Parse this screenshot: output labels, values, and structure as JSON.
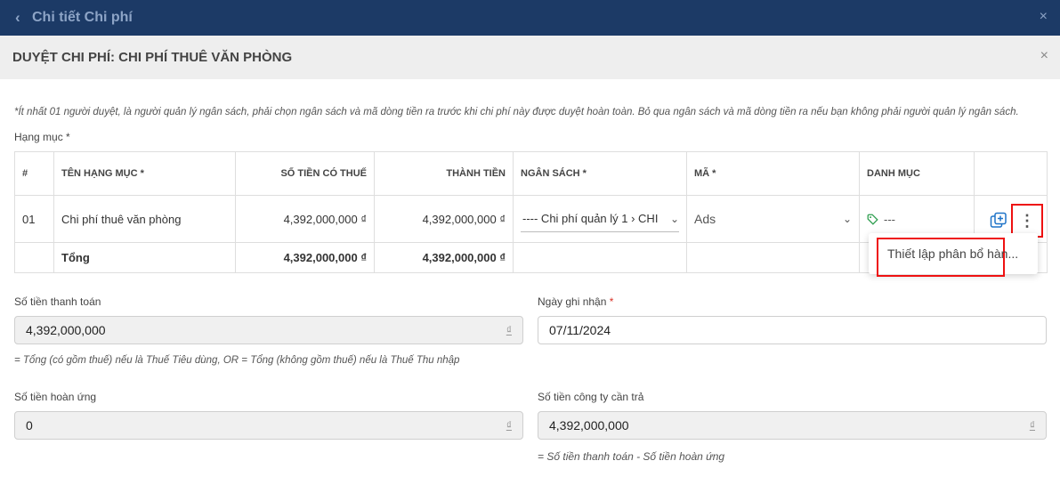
{
  "topbar": {
    "title": "Chi tiết Chi phí",
    "back_glyph": "‹",
    "close_glyph": "×"
  },
  "dialog": {
    "title": "DUYỆT CHI PHÍ: CHI PHÍ THUÊ VĂN PHÒNG",
    "close_glyph": "×"
  },
  "note": "*Ít nhất 01 người duyệt, là người quản lý ngân sách, phải chọn ngân sách và mã dòng tiền ra trước khi chi phí này được duyệt hoàn toàn. Bỏ qua ngân sách và mã dòng tiền ra nếu bạn không phải người quản lý ngân sách.",
  "items_label": "Hạng mục *",
  "table": {
    "headers": [
      "#",
      "TÊN HẠNG MỤC *",
      "SỐ TIỀN CÓ THUẾ",
      "THÀNH TIỀN",
      "NGÂN SÁCH *",
      "MÃ *",
      "DANH MỤC",
      ""
    ],
    "row": {
      "index": "01",
      "name": "Chi phí thuê văn phòng",
      "amount_tax": "4,392,000,000 ₫",
      "total": "4,392,000,000 ₫",
      "budget": "---- Chi phí quản lý 1 › CHI",
      "code": "Ads",
      "category": "---"
    },
    "total_row": {
      "label": "Tổng",
      "amount_tax": "4,392,000,000 ₫",
      "total": "4,392,000,000 ₫"
    }
  },
  "row_menu": {
    "more_glyph": "⋮",
    "item": "Thiết lập phân bổ hàn..."
  },
  "fields": {
    "payment_label": "Số tiền thanh toán",
    "payment_value": "4,392,000,000",
    "payment_hint": "= Tổng (có gồm thuế) nếu là Thuế Tiêu dùng, OR = Tổng (không gồm thuế) nếu là Thuế Thu nhập",
    "date_label": "Ngày ghi nhận",
    "date_req": "*",
    "date_value": "07/11/2024",
    "refund_label": "Số tiền hoàn ứng",
    "refund_value": "0",
    "company_label": "Số tiền công ty cần trả",
    "company_value": "4,392,000,000",
    "company_hint": "= Số tiền thanh toán - Số tiền hoàn ứng",
    "currency": "₫"
  },
  "colors": {
    "topbar": "#1c3a66",
    "highlight": "#ee1111",
    "tag": "#2e9e4f",
    "copy_icon": "#1e73c8"
  }
}
